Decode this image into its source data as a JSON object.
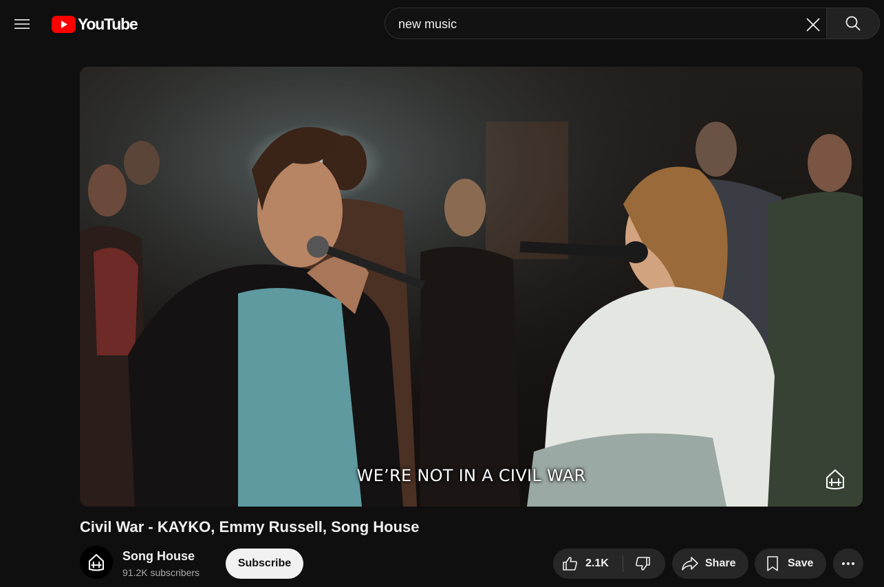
{
  "header": {
    "logo_text": "YouTube",
    "search": {
      "value": "new music"
    }
  },
  "player": {
    "caption": "WE’RE NOT IN A CIVIL WAR"
  },
  "video": {
    "title": "Civil War - KAYKO, Emmy Russell, Song House"
  },
  "channel": {
    "name": "Song House",
    "subscribers": "91.2K subscribers",
    "subscribe_label": "Subscribe"
  },
  "actions": {
    "like_count": "2.1K",
    "share_label": "Share",
    "save_label": "Save"
  },
  "colors": {
    "background": "#0f0f0f",
    "brand_red": "#ff0000",
    "pill": "#272727",
    "subscribe_bg": "#f1f1f1"
  },
  "icons": [
    "menu-icon",
    "youtube-logo-icon",
    "close-icon",
    "search-icon",
    "song-house-logo-icon",
    "thumbs-up-icon",
    "thumbs-down-icon",
    "share-arrow-icon",
    "bookmark-icon",
    "more-horizontal-icon"
  ]
}
